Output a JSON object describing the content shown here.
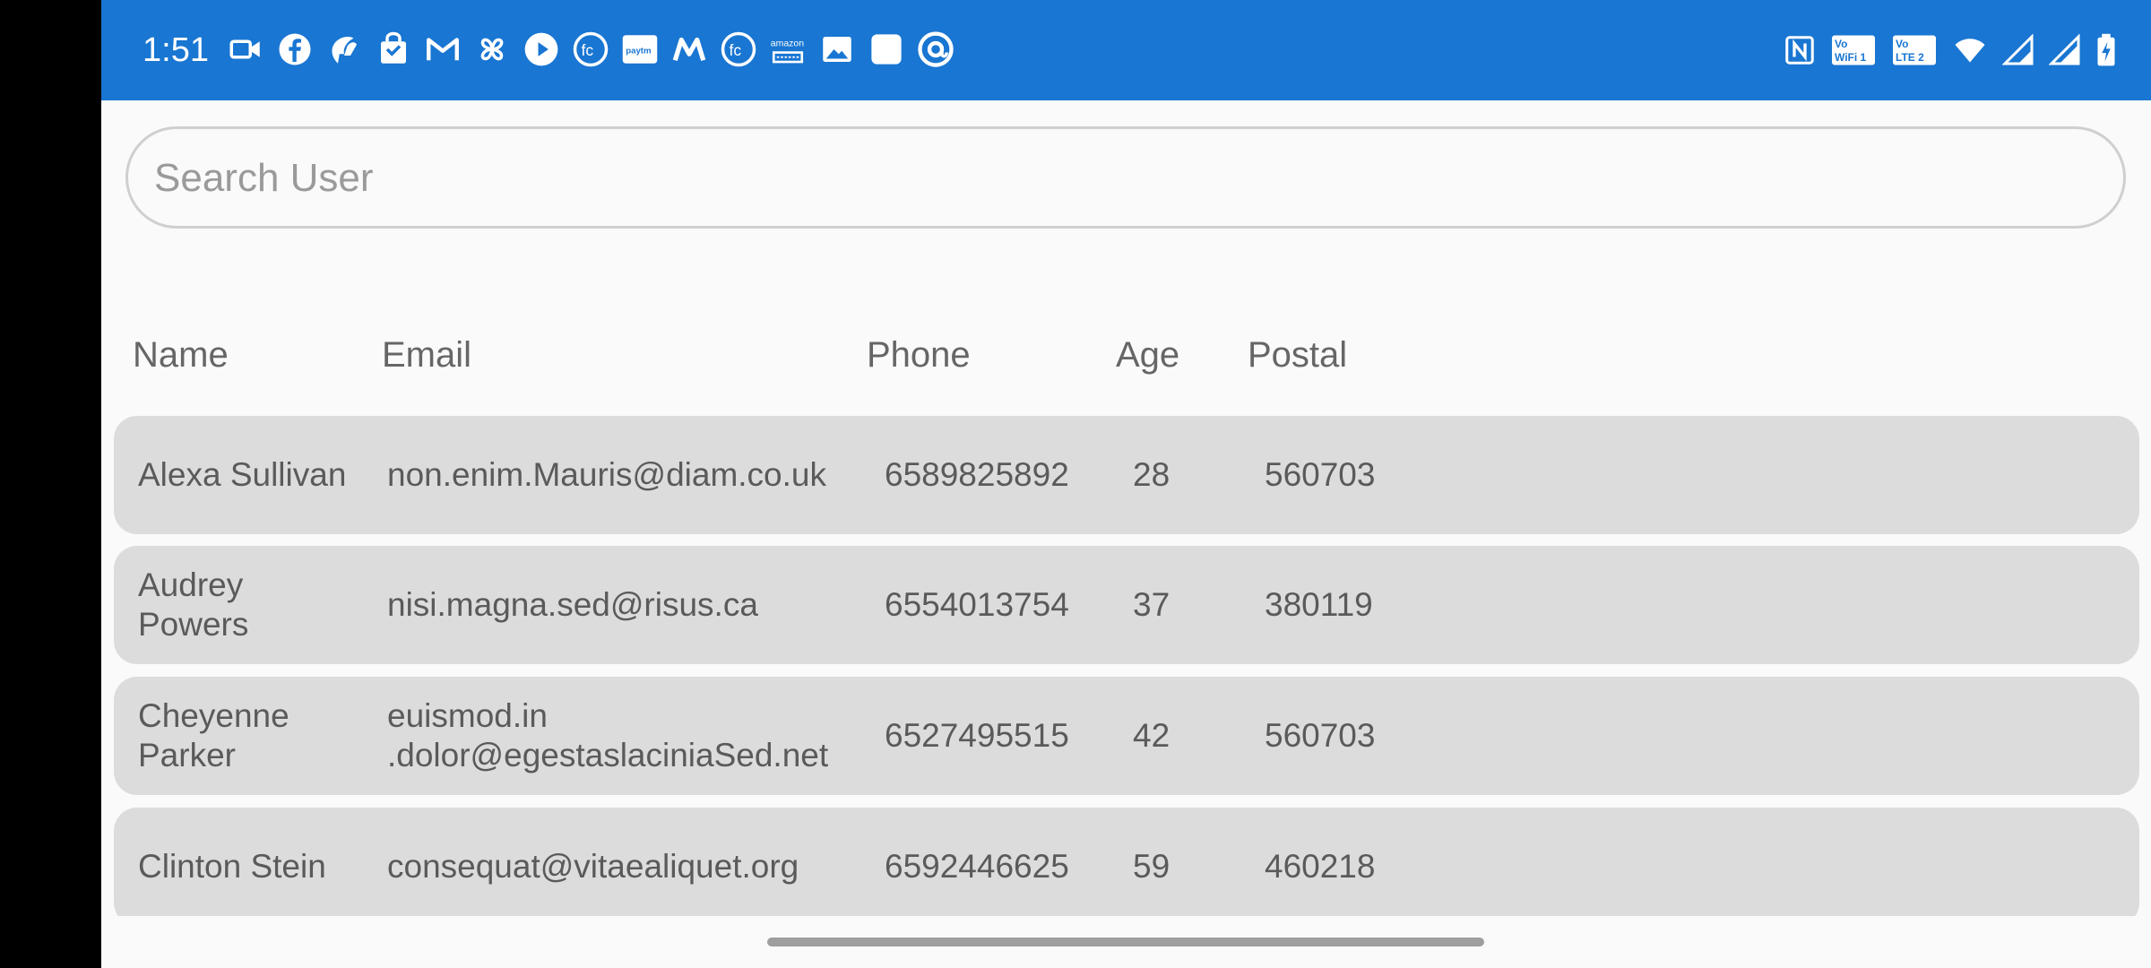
{
  "status_bar": {
    "time": "1:51",
    "notification_icons": [
      "video-camera-icon",
      "facebook-icon",
      "swiggy-icon",
      "shopping-bag-icon",
      "gmail-icon",
      "pinwheel-icon",
      "play-icon",
      "freecharge-icon",
      "paytm-icon",
      "myntra-icon",
      "freecharge-icon",
      "amazon-icon",
      "gallery-icon",
      "square-app-icon",
      "at-sign-icon"
    ],
    "system_icons": [
      "nfc-icon",
      "vowifi-icon",
      "volte-icon",
      "wifi-icon",
      "signal-icon",
      "signal-icon",
      "battery-charging-icon"
    ],
    "vowifi_label": "Vo WiFi 1",
    "volte_label": "Vo LTE 2",
    "paytm_label": "paytm",
    "amazon_label": "amazon"
  },
  "search": {
    "placeholder": "Search User",
    "value": ""
  },
  "table": {
    "headers": {
      "name": "Name",
      "email": "Email",
      "phone": "Phone",
      "age": "Age",
      "postal": "Postal"
    },
    "rows": [
      {
        "name": "Alexa Sullivan",
        "email": "non.enim.Mauris@diam.co.uk",
        "phone": "6589825892",
        "age": "28",
        "postal": "560703"
      },
      {
        "name": "Audrey Powers",
        "email": "nisi.magna.sed@risus.ca",
        "phone": "6554013754",
        "age": "37",
        "postal": "380119"
      },
      {
        "name": "Cheyenne Parker",
        "email": "euismod.in .dolor@egestaslaciniaSed.net",
        "phone": "6527495515",
        "age": "42",
        "postal": "560703"
      },
      {
        "name": "Clinton Stein",
        "email": "consequat@vitaealiquet.org",
        "phone": "6592446625",
        "age": "59",
        "postal": "460218"
      }
    ]
  },
  "colors": {
    "status_bar": "#1976d2",
    "row_bg": "#dcdcdc",
    "background": "#fafafa"
  }
}
